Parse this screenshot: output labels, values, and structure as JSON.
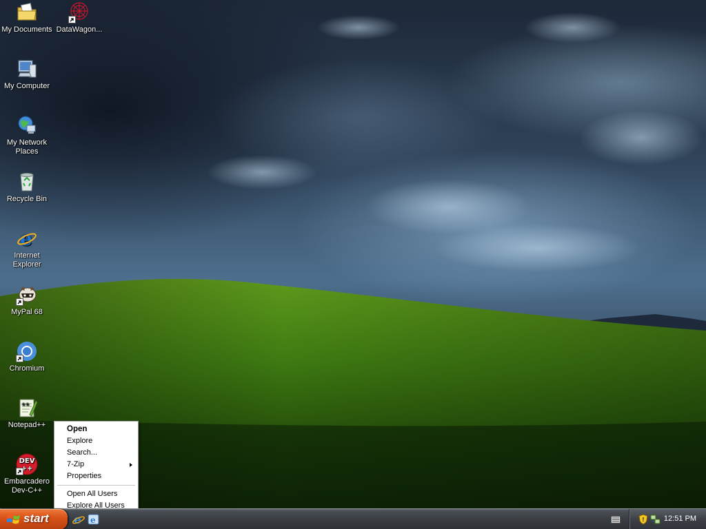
{
  "desktop": {
    "icons": [
      {
        "label": "My Documents",
        "icon": "my-documents-icon",
        "shortcut": false
      },
      {
        "label": "DataWagon...",
        "icon": "datawagon-icon",
        "shortcut": true
      },
      {
        "label": "My Computer",
        "icon": "my-computer-icon",
        "shortcut": false
      },
      {
        "label": "My Network Places",
        "icon": "network-places-icon",
        "shortcut": false
      },
      {
        "label": "Recycle Bin",
        "icon": "recycle-bin-icon",
        "shortcut": false
      },
      {
        "label": "Internet Explorer",
        "icon": "internet-explorer-icon",
        "shortcut": false
      },
      {
        "label": "MyPal 68",
        "icon": "mypal-icon",
        "shortcut": true
      },
      {
        "label": "Chromium",
        "icon": "chromium-icon",
        "shortcut": true
      },
      {
        "label": "Notepad++",
        "icon": "notepad-plus-plus-icon",
        "shortcut": false
      },
      {
        "label": "Embarcadero Dev-C++",
        "icon": "devcpp-icon",
        "shortcut": true
      }
    ]
  },
  "context_menu": {
    "items": [
      {
        "label": "Open",
        "default": true
      },
      {
        "label": "Explore"
      },
      {
        "label": "Search..."
      },
      {
        "label": "7-Zip",
        "submenu": true
      },
      {
        "label": "Properties"
      },
      {
        "separator": true
      },
      {
        "label": "Open All Users"
      },
      {
        "label": "Explore All Users"
      }
    ]
  },
  "taskbar": {
    "start_label": "start",
    "quick_launch": [
      "internet-explorer-icon",
      "ie-settings-icon"
    ],
    "tray_icons": [
      "keyboard-icon",
      "security-shield-icon",
      "network-icon"
    ],
    "clock": "12:51 PM"
  },
  "colors": {
    "start_button": "#d9541a",
    "taskbar": "#3a3e43",
    "menu_bg": "#ffffff"
  },
  "devcpp_badge": "DEV\n++"
}
